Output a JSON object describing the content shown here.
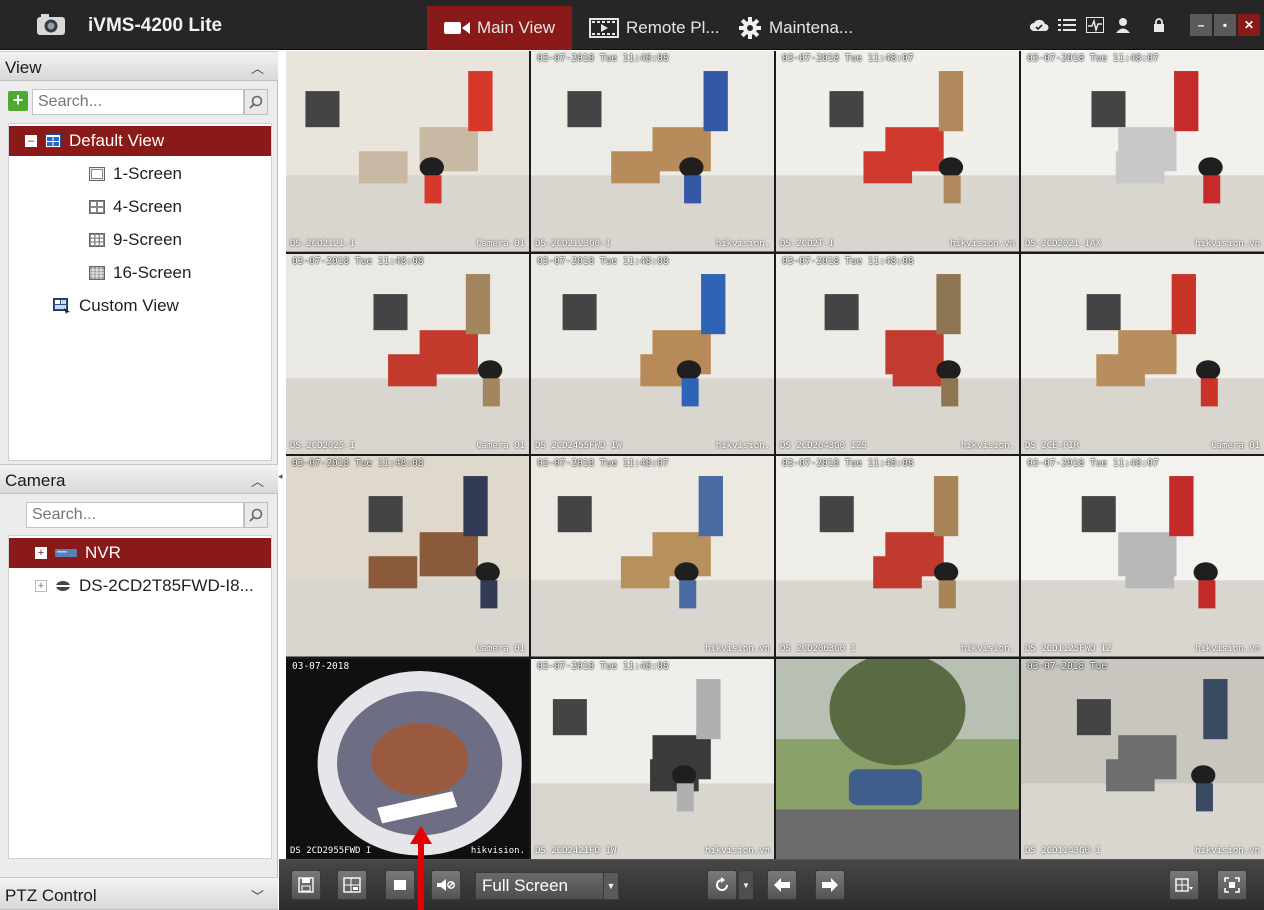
{
  "app": {
    "title": "iVMS-4200 Lite"
  },
  "nav": {
    "tabs": [
      {
        "label": "Main View",
        "active": true
      },
      {
        "label": "Remote Pl...",
        "active": false
      },
      {
        "label": "Maintena...",
        "active": false
      }
    ]
  },
  "titlebar_icons": [
    "cloud-icon",
    "list-icon",
    "alarm-icon",
    "user-icon",
    "lock-icon",
    "minimize-icon",
    "maximize-icon",
    "close-icon"
  ],
  "view_panel": {
    "header": "View",
    "search_placeholder": "Search...",
    "items": [
      {
        "label": "Default View",
        "icon": "view-grid-icon",
        "selected": true,
        "expanded": true
      },
      {
        "label": "1-Screen",
        "icon": "screen-1-icon"
      },
      {
        "label": "4-Screen",
        "icon": "screen-4-icon"
      },
      {
        "label": "9-Screen",
        "icon": "screen-9-icon"
      },
      {
        "label": "16-Screen",
        "icon": "screen-16-icon"
      },
      {
        "label": "Custom View",
        "icon": "custom-view-icon"
      }
    ]
  },
  "camera_panel": {
    "header": "Camera",
    "search_placeholder": "Search...",
    "items": [
      {
        "label": "NVR",
        "icon": "nvr-icon",
        "selected": true
      },
      {
        "label": "DS-2CD2T85FWD-I8...",
        "icon": "camera-icon",
        "selected": false
      }
    ]
  },
  "ptz_panel": {
    "header": "PTZ Control"
  },
  "video_cells": [
    {
      "timestamp": "",
      "name": "DS-2CD2121-I",
      "watermark": "Camera 01",
      "selected": true
    },
    {
      "timestamp": "03-07-2018 Tue 11:48:08",
      "name": "DS-2CD2123G0-I",
      "watermark": "hikvision."
    },
    {
      "timestamp": "03-07-2018 Tue 11:48:07",
      "name": "DS-2CD2T-I",
      "watermark": "hikvision.vn"
    },
    {
      "timestamp": "03-07-2018 Tue 11:48:07",
      "name": "DS-2CD2021-IAX",
      "watermark": "hikvision.vn"
    },
    {
      "timestamp": "03-07-2018 Tue 11:48:08",
      "name": "DS-2CD2025-I",
      "watermark": "Camera 01"
    },
    {
      "timestamp": "03-07-2018 Tue 11:48:08",
      "name": "DS 2CD2455FWD IW",
      "watermark": "hikvision."
    },
    {
      "timestamp": "03-07-2018 Tue 11:48:08",
      "name": "DS 2CD2643G0 IZS",
      "watermark": "hikvision."
    },
    {
      "timestamp": "",
      "name": "DS 2CE-PIR",
      "watermark": "Camera 01"
    },
    {
      "timestamp": "03-07-2018 Tue 11:48:08",
      "name": "",
      "watermark": "Camera 01"
    },
    {
      "timestamp": "03-07-2018 Tue 11:48:07",
      "name": "",
      "watermark": "hikvision.vn"
    },
    {
      "timestamp": "03-07-2018 Tue 11:48:08",
      "name": "DS 2CD2063G0 I",
      "watermark": "hikvision."
    },
    {
      "timestamp": "03-07-2018 Tue 11:48:07",
      "name": "DS 2CD1125FWD IZ",
      "watermark": "hikvision.vn"
    },
    {
      "timestamp": "03-07-2018",
      "name": "DS 2CD2955FWD I",
      "watermark": "hikvision."
    },
    {
      "timestamp": "03-07-2018 Tue 11:48:08",
      "name": "DS 2CD2421FD IW",
      "watermark": "hikvision.vn"
    },
    {
      "timestamp": "",
      "name": "",
      "watermark": ""
    },
    {
      "timestamp": "03-07-2018 Tue",
      "name": "DS 2CD1143G0-I",
      "watermark": "hikvision.vn"
    }
  ],
  "bottom_bar": {
    "view_mode": "Full Screen"
  },
  "colors": {
    "titlebar": "#262626",
    "accent": "#8a1a1a",
    "panel_bg": "#ececec",
    "toolbar": "#3a3a3a"
  }
}
